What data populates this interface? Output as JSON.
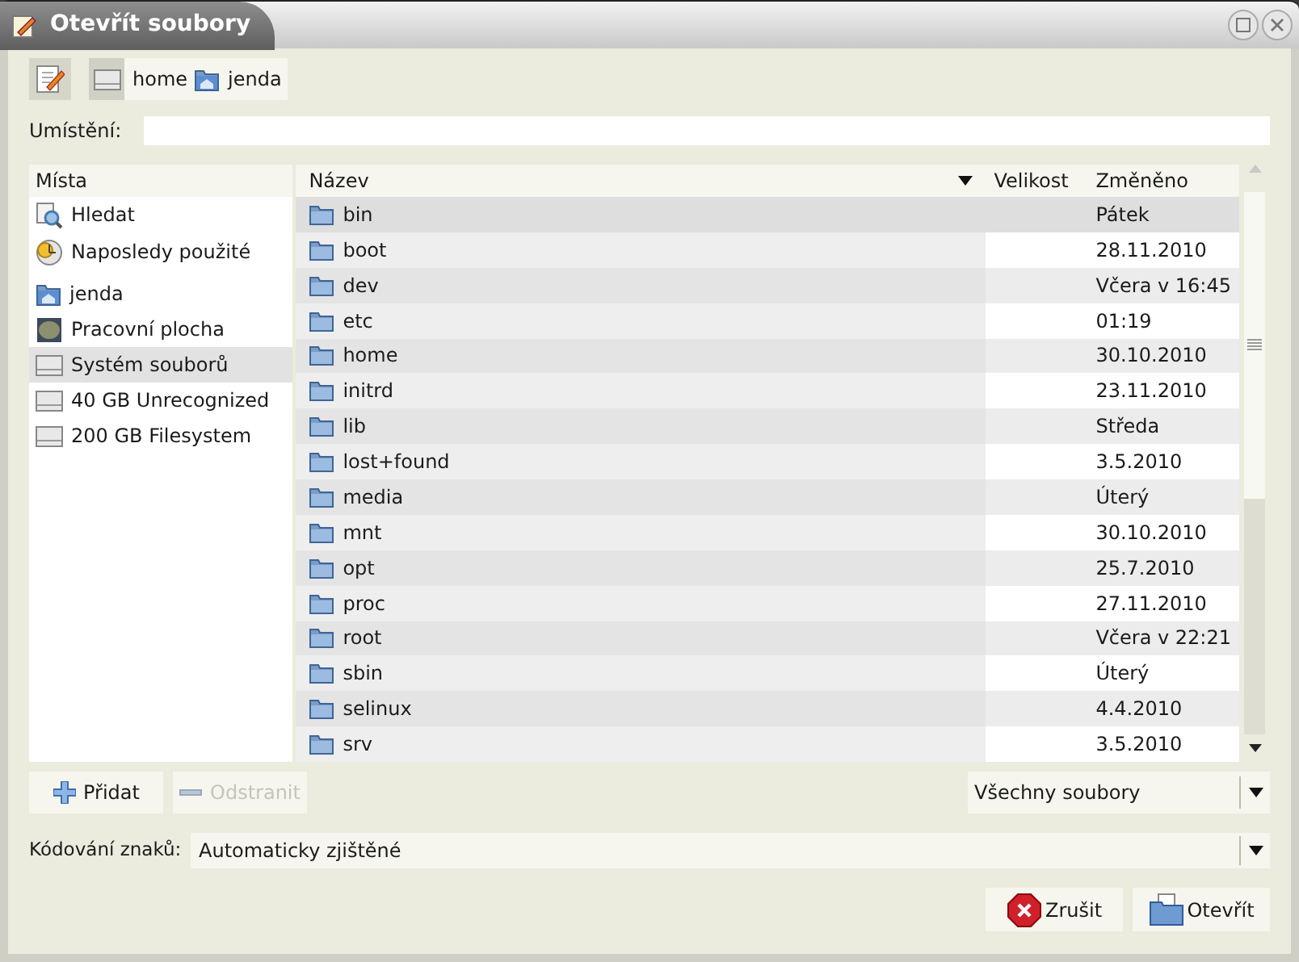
{
  "window": {
    "title": "Otevřít soubory"
  },
  "path_bar": [
    {
      "label": "home",
      "kind": "drive",
      "selected": true
    },
    {
      "label": "jenda",
      "kind": "home",
      "selected": false
    }
  ],
  "location": {
    "label": "Umístění:"
  },
  "places": {
    "heading": "Místa",
    "items": [
      {
        "label": "Hledat",
        "kind": "search",
        "selected": false
      },
      {
        "label": "Naposledy použité",
        "kind": "recent",
        "selected": false
      },
      {
        "label": "jenda",
        "kind": "home",
        "selected": false
      },
      {
        "label": "Pracovní plocha",
        "kind": "desktop",
        "selected": false
      },
      {
        "label": "Systém souborů",
        "kind": "drive",
        "selected": true
      },
      {
        "label": "40 GB Unrecognized",
        "kind": "drive",
        "selected": false
      },
      {
        "label": "200 GB Filesystem",
        "kind": "drive",
        "selected": false
      }
    ]
  },
  "files": {
    "columns": [
      "Název",
      "Velikost",
      "Změněno"
    ],
    "rows": [
      {
        "name": "bin",
        "modified": "Pátek",
        "selected": true
      },
      {
        "name": "boot",
        "modified": "28.11.2010",
        "selected": false
      },
      {
        "name": "dev",
        "modified": "Včera v 16:45",
        "selected": false
      },
      {
        "name": "etc",
        "modified": "01:19",
        "selected": false
      },
      {
        "name": "home",
        "modified": "30.10.2010",
        "selected": false
      },
      {
        "name": "initrd",
        "modified": "23.11.2010",
        "selected": false
      },
      {
        "name": "lib",
        "modified": "Středa",
        "selected": false
      },
      {
        "name": "lost+found",
        "modified": "3.5.2010",
        "selected": false
      },
      {
        "name": "media",
        "modified": "Úterý",
        "selected": false
      },
      {
        "name": "mnt",
        "modified": "30.10.2010",
        "selected": false
      },
      {
        "name": "opt",
        "modified": "25.7.2010",
        "selected": false
      },
      {
        "name": "proc",
        "modified": "27.11.2010",
        "selected": false
      },
      {
        "name": "root",
        "modified": "Včera v 22:21",
        "selected": false
      },
      {
        "name": "sbin",
        "modified": "Úterý",
        "selected": false
      },
      {
        "name": "selinux",
        "modified": "4.4.2010",
        "selected": false
      },
      {
        "name": "srv",
        "modified": "3.5.2010",
        "selected": false
      }
    ]
  },
  "add_button": {
    "label": "Přidat",
    "disabled": false
  },
  "remove_button": {
    "label": "Odstranit",
    "disabled": true
  },
  "filter": {
    "value": "Všechny soubory"
  },
  "encoding": {
    "label": "Kódování znaků:",
    "value": "Automaticky zjištěné"
  },
  "buttons": [
    {
      "label": "Zrušit",
      "kind": "cancel"
    },
    {
      "label": "Otevřít",
      "kind": "open"
    }
  ]
}
